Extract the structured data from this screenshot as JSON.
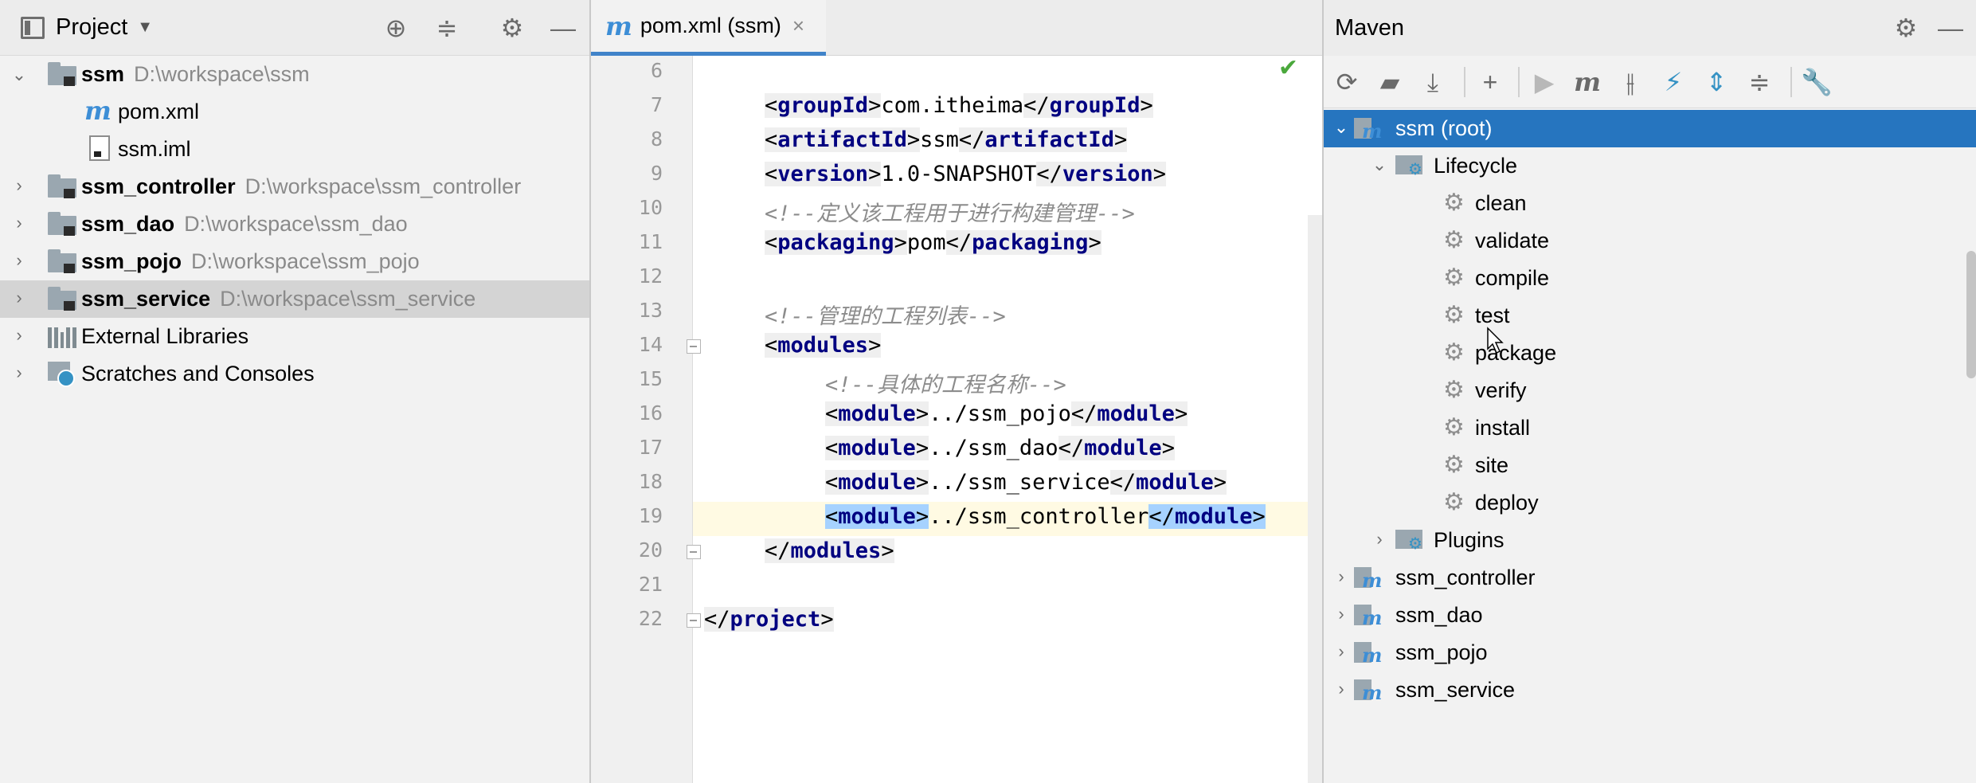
{
  "project_panel": {
    "title": "Project",
    "tree": [
      {
        "name": "ssm",
        "path": "D:\\workspace\\ssm",
        "expanded": true
      },
      {
        "name": "pom.xml"
      },
      {
        "name": "ssm.iml"
      },
      {
        "name": "ssm_controller",
        "path": "D:\\workspace\\ssm_controller"
      },
      {
        "name": "ssm_dao",
        "path": "D:\\workspace\\ssm_dao"
      },
      {
        "name": "ssm_pojo",
        "path": "D:\\workspace\\ssm_pojo"
      },
      {
        "name": "ssm_service",
        "path": "D:\\workspace\\ssm_service",
        "selected": true
      },
      {
        "name": "External Libraries"
      },
      {
        "name": "Scratches and Consoles"
      }
    ]
  },
  "editor": {
    "tab_label": "pom.xml (ssm)",
    "tab_close": "×",
    "line_numbers": [
      "6",
      "7",
      "8",
      "9",
      "10",
      "11",
      "12",
      "13",
      "14",
      "15",
      "16",
      "17",
      "18",
      "19",
      "20",
      "21",
      "22"
    ],
    "lines": {
      "l7_tag": "groupId",
      "l7_val": "com.itheima",
      "l8_tag": "artifactId",
      "l8_val": "ssm",
      "l9_tag": "version",
      "l9_val": "1.0-SNAPSHOT",
      "l10_comment": "<!--定义该工程用于进行构建管理-->",
      "l11_tag": "packaging",
      "l11_val": "pom",
      "l13_comment": "<!--管理的工程列表-->",
      "l14_tag": "modules",
      "l15_comment": "<!--具体的工程名称-->",
      "l16_val": "../ssm_pojo",
      "l17_val": "../ssm_dao",
      "l18_val": "../ssm_service",
      "l19_val": "../ssm_controller",
      "module_tag": "module",
      "l22_tag": "project"
    }
  },
  "maven_panel": {
    "title": "Maven",
    "root": "ssm (root)",
    "lifecycle_label": "Lifecycle",
    "phases": [
      "clean",
      "validate",
      "compile",
      "test",
      "package",
      "verify",
      "install",
      "site",
      "deploy"
    ],
    "plugins_label": "Plugins",
    "modules": [
      "ssm_controller",
      "ssm_dao",
      "ssm_pojo",
      "ssm_service"
    ]
  },
  "colors": {
    "selection_blue": "#2675bf",
    "xml_tag": "#000080",
    "comment": "#8c8c8c",
    "maven_icon": "#3d8ed6"
  },
  "icons": [
    "locate-icon",
    "collapse-icon",
    "gear-icon",
    "minimize-icon",
    "close-icon",
    "reload-icon",
    "add-folder-icon",
    "download-icon",
    "plus-icon",
    "run-icon",
    "maven-goal-icon",
    "toggle-offline-icon",
    "skip-tests-icon",
    "expand-all-icon",
    "collapse-all-icon",
    "wrench-icon",
    "checkmark-icon"
  ]
}
